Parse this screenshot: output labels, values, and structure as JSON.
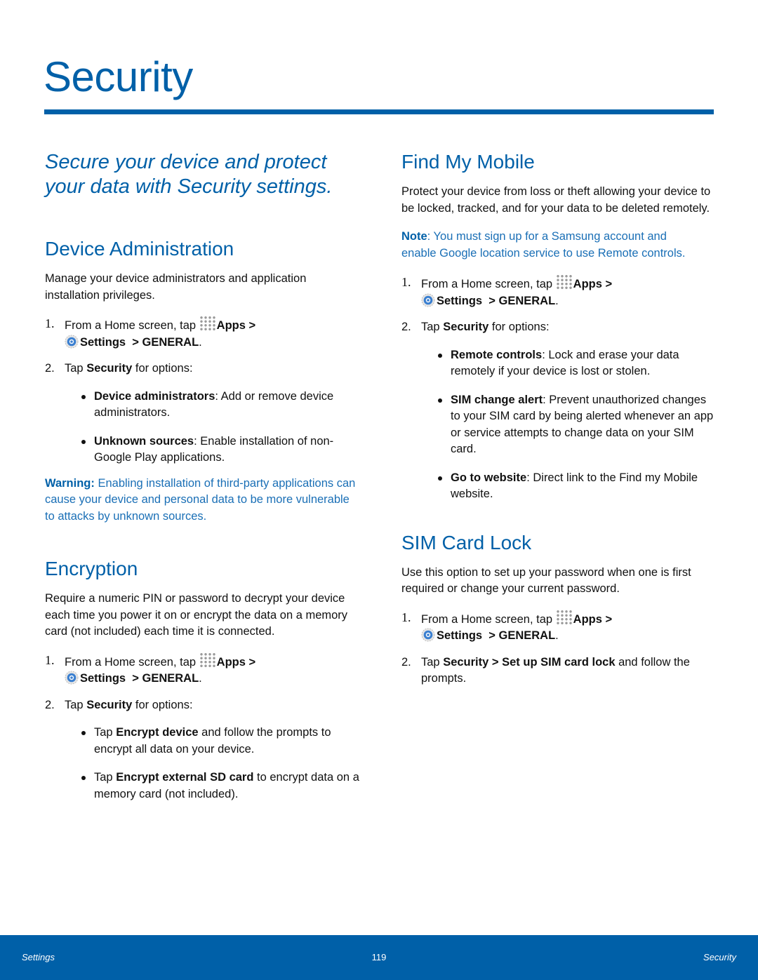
{
  "page": {
    "title": "Security",
    "accent_color": "#0060a8"
  },
  "left": {
    "intro": "Secure your device and protect your data with Security settings.",
    "device_admin": {
      "heading": "Device Administration",
      "description": "Manage your device administrators and application installation privileges.",
      "step1": {
        "num": "1.",
        "prefix": "From a Home screen, tap ",
        "apps": "Apps",
        "sep1": " >",
        "settings": "Settings",
        "sep2": "  > ",
        "general": "GENERAL",
        "end": "."
      },
      "step2": {
        "num": "2.",
        "prefix": "Tap ",
        "bold": "Security",
        "suffix": " for options:"
      },
      "bullets": [
        {
          "bold": "Device administrators",
          "text": ": Add or remove device administrators."
        },
        {
          "bold": "Unknown sources",
          "text": ": Enable installation of non-Google Play applications."
        }
      ],
      "warning": {
        "label": "Warning:",
        "text": " Enabling installation of third-party applications can cause your device and personal data to be more vulnerable to attacks by unknown sources."
      }
    },
    "encryption": {
      "heading": "Encryption",
      "description": "Require a numeric PIN or password to decrypt your device each time you power it on or encrypt the data on a memory card (not included) each time it is connected.",
      "step1": {
        "num": "1.",
        "prefix": "From a Home screen, tap ",
        "apps": "Apps",
        "sep1": " >",
        "settings": "Settings",
        "sep2": "  > ",
        "general": "GENERAL",
        "end": "."
      },
      "step2": {
        "num": "2.",
        "prefix": "Tap ",
        "bold": "Security",
        "suffix": " for options:"
      },
      "bullets": [
        {
          "prefix": "Tap ",
          "bold": "Encrypt device",
          "text": " and follow the prompts to encrypt all data on your device."
        },
        {
          "prefix": "Tap ",
          "bold": "Encrypt external SD card",
          "text": " to encrypt data on a memory card (not included)."
        }
      ]
    }
  },
  "right": {
    "find_my_mobile": {
      "heading": "Find My Mobile",
      "description": "Protect your device from loss or theft allowing your device to be locked, tracked, and for your data to be deleted remotely.",
      "note": {
        "label": "Note",
        "text": ": You must sign up for a Samsung account and enable Google location service to use Remote controls."
      },
      "step1": {
        "num": "1.",
        "prefix": "From a Home screen, tap ",
        "apps": "Apps",
        "sep1": " >",
        "settings": "Settings",
        "sep2": "  > ",
        "general": "GENERAL",
        "end": "."
      },
      "step2": {
        "num": "2.",
        "prefix": "Tap ",
        "bold": "Security",
        "suffix": " for options:"
      },
      "bullets": [
        {
          "bold": "Remote controls",
          "text": ": Lock and erase your data remotely if your device is lost or stolen."
        },
        {
          "bold": "SIM change alert",
          "text": ": Prevent unauthorized changes to your SIM card by being alerted whenever an app or service attempts to change data on your SIM card."
        },
        {
          "bold": "Go to website",
          "text": ": Direct link to the Find my Mobile website."
        }
      ]
    },
    "sim_card_lock": {
      "heading": "SIM Card Lock",
      "description": "Use this option to set up your password when one is first required or change your current password.",
      "step1": {
        "num": "1.",
        "prefix": "From a Home screen, tap ",
        "apps": "Apps",
        "sep1": " >",
        "settings": "Settings",
        "sep2": "  > ",
        "general": "GENERAL",
        "end": "."
      },
      "step2": {
        "num": "2.",
        "prefix": "Tap ",
        "bold": "Security",
        "mid": " > ",
        "bold2": "Set up SIM card lock",
        "suffix": " and follow the prompts."
      }
    }
  },
  "footer": {
    "left": "Settings",
    "page_number": "119",
    "right": "Security"
  }
}
